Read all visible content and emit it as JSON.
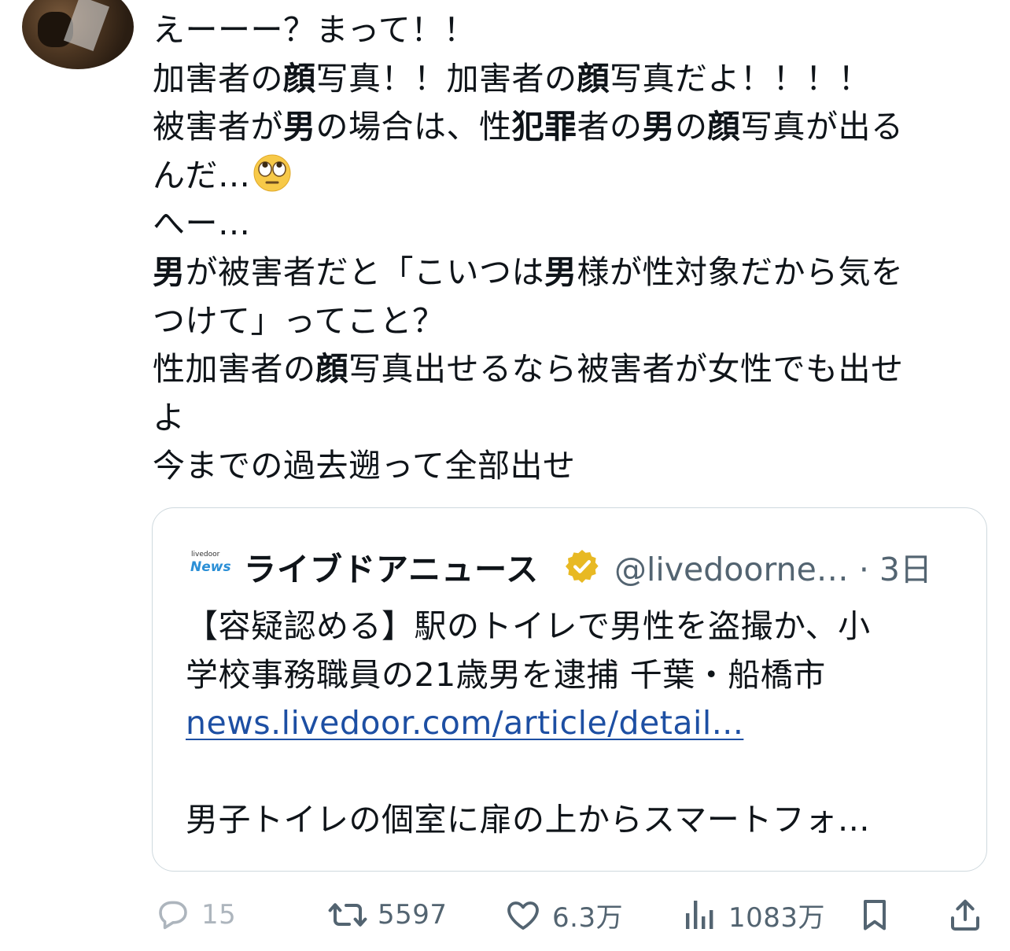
{
  "tweet": {
    "avatar_alt": "",
    "lines": [
      [
        {
          "t": "えーーー？まって！！"
        }
      ],
      [
        {
          "t": "加害者の"
        },
        {
          "t": "顔",
          "b": true
        },
        {
          "t": "写真！！加害者の"
        },
        {
          "t": "顔",
          "b": true
        },
        {
          "t": "写真だよ！！！！"
        }
      ],
      [
        {
          "t": "被害者が"
        },
        {
          "t": "男",
          "b": true
        },
        {
          "t": "の場合は、性"
        },
        {
          "t": "犯罪",
          "b": true
        },
        {
          "t": "者の"
        },
        {
          "t": "男",
          "b": true
        },
        {
          "t": "の"
        },
        {
          "t": "顔",
          "b": true
        },
        {
          "t": "写真が出る"
        }
      ],
      [
        {
          "t": "んだ…"
        },
        {
          "emoji": "face-with-rolling-eyes"
        }
      ],
      [
        {
          "t": "へー…"
        }
      ],
      [
        {
          "t": "男",
          "b": true
        },
        {
          "t": "が被害者だと「こいつは"
        },
        {
          "t": "男",
          "b": true
        },
        {
          "t": "様が性対象だから気を"
        }
      ],
      [
        {
          "t": "つけて」ってこと？"
        }
      ],
      [
        {
          "t": "性加害者の"
        },
        {
          "t": "顔",
          "b": true
        },
        {
          "t": "写真出せるなら被害者が女性でも出せ"
        }
      ],
      [
        {
          "t": "よ"
        }
      ],
      [
        {
          "t": "今までの過去遡って全部出せ"
        }
      ]
    ]
  },
  "quote": {
    "logo_small": "livedoor",
    "logo_main": "News",
    "name": "ライブドアニュース",
    "handle_time": "@livedoorne… · 3日",
    "body_lines": [
      "【容疑認める】駅のトイレで男性を盗撮か、小",
      "学校事務職員の21歳男を逮捕 千葉・船橋市"
    ],
    "link": "news.livedoor.com/article/detail...",
    "snippet": "男子トイレの個室に扉の上からスマートフォ…",
    "verified_color": "#e8b923"
  },
  "actions": {
    "replies": "15",
    "retweets": "5597",
    "likes": "6.3万",
    "views": "1083万"
  }
}
